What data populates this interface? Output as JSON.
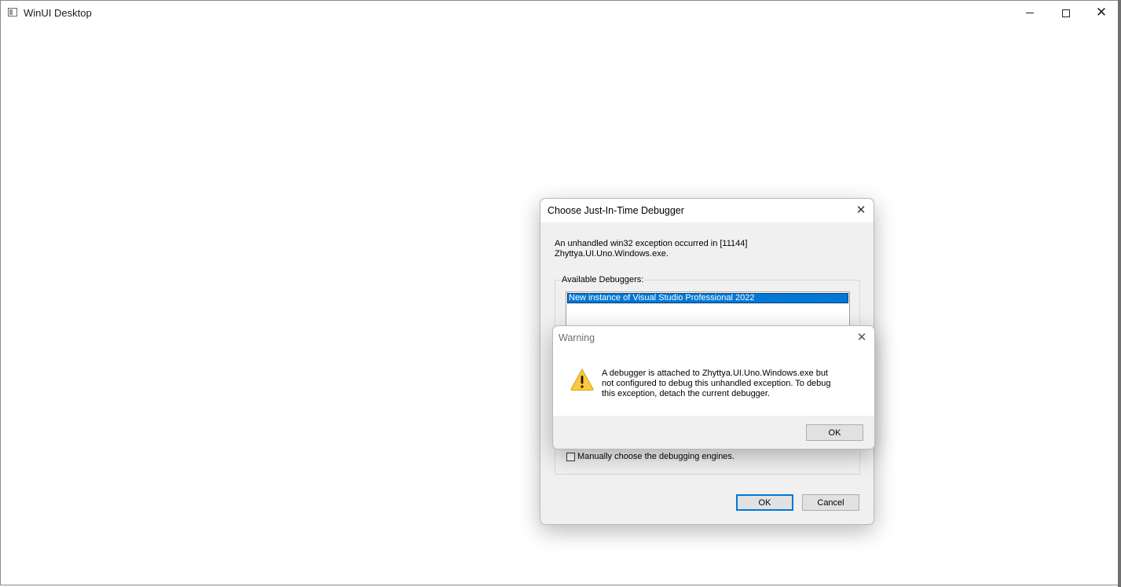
{
  "window": {
    "title": "WinUI Desktop",
    "controls": {
      "minimize": "minimize-icon",
      "maximize": "maximize-icon",
      "close": "close-icon"
    }
  },
  "jit_dialog": {
    "title": "Choose Just-In-Time Debugger",
    "message_line1": "An unhandled win32 exception occurred in [11144]",
    "message_line2": "Zhyttya.UI.Uno.Windows.exe.",
    "available_label": "Available Debuggers:",
    "debuggers": [
      "New instance of Visual Studio Professional 2022"
    ],
    "selected_index": 0,
    "manual_checkbox_label": "Manually choose the debugging engines.",
    "manual_checked": false,
    "ok_label": "OK",
    "cancel_label": "Cancel"
  },
  "warning_dialog": {
    "title": "Warning",
    "icon": "warning-icon",
    "message_line1": "A debugger is attached to Zhyttya.UI.Uno.Windows.exe but",
    "message_line2": "not configured to debug this unhandled exception. To debug",
    "message_line3": "this exception, detach the current debugger.",
    "ok_label": "OK"
  },
  "colors": {
    "selection": "#0078d7",
    "dialog_bg": "#f0f0f0",
    "warning_yellow": "#ffc83d"
  }
}
